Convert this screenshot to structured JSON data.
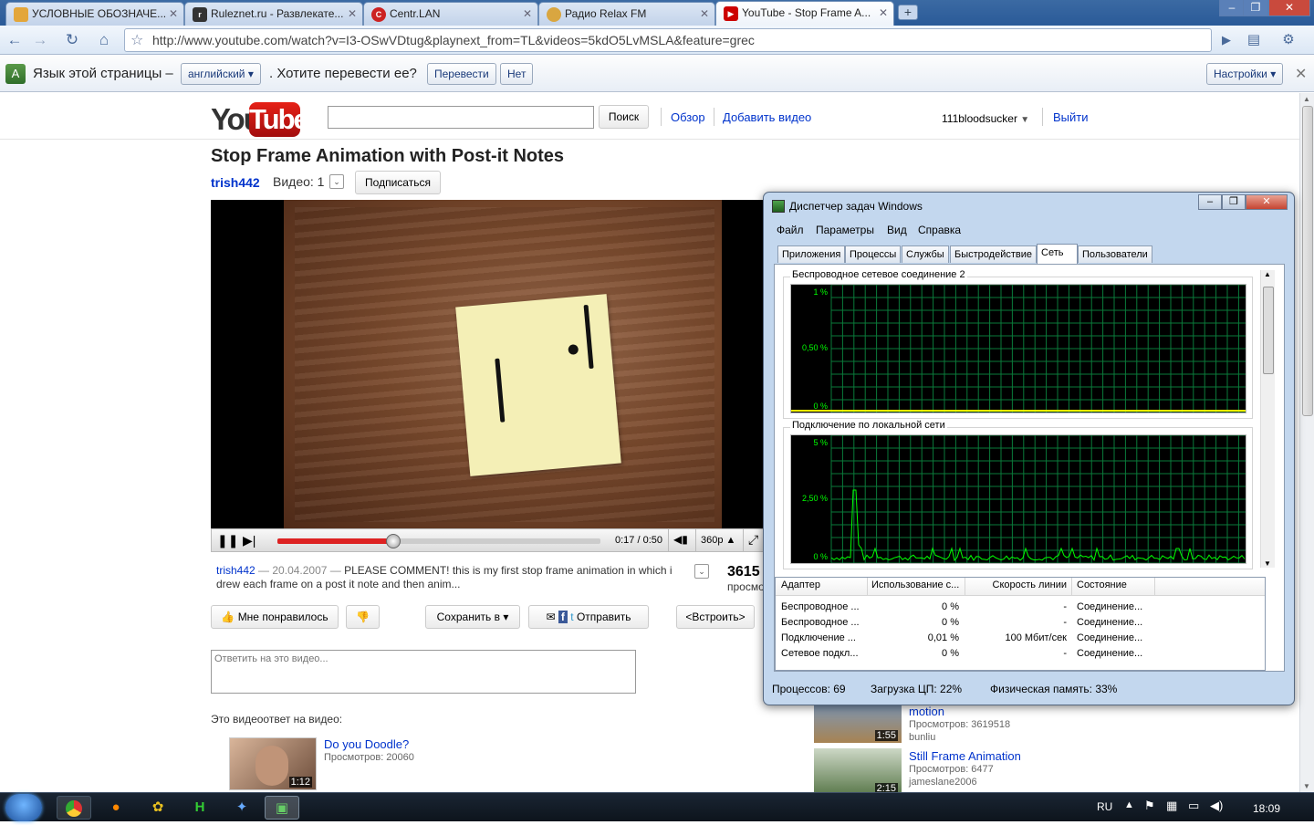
{
  "browser": {
    "tabs": [
      {
        "label": "УСЛОВНЫЕ ОБОЗНАЧЕ...",
        "icon": "page-icon",
        "color": "#e3a63a"
      },
      {
        "label": "Ruleznet.ru - Развлекате...",
        "icon": "ruleznet-icon",
        "color": "#333333"
      },
      {
        "label": "Centr.LAN",
        "icon": "centr-icon",
        "color": "#cc2222"
      },
      {
        "label": "Радио Relax FM",
        "icon": "radio-icon",
        "color": "#d9a640"
      },
      {
        "label": "YouTube - Stop Frame A...",
        "icon": "youtube-icon",
        "color": "#cc0000"
      }
    ],
    "new_tab": "+",
    "url": "http://www.youtube.com/watch?v=I3-OSwVDtug&playnext_from=TL&videos=5kdO5LvMSLA&feature=grec",
    "infobar": {
      "text1": "Язык этой страницы –",
      "language": "английский",
      "text2": ". Хотите перевести ее?",
      "translate": "Перевести",
      "no": "Нет",
      "settings": "Настройки"
    }
  },
  "youtube": {
    "logo_you": "You",
    "logo_tube": "Tube",
    "search_button": "Поиск",
    "nav_browse": "Обзор",
    "nav_upload": "Добавить видео",
    "username": "111bloodsucker",
    "logout": "Выйти",
    "video_title": "Stop Frame Animation with Post-it Notes",
    "channel": "trish442",
    "videos_label": "Видео: 1",
    "subscribe": "Подписаться",
    "player": {
      "time": "0:17 / 0:50",
      "quality": "360p",
      "progress": 0.36
    },
    "desc_user": "trish442",
    "desc_date": "— 20.04.2007 —",
    "desc_text": "PLEASE COMMENT! this is my first stop frame animation in which i drew each frame on a post it note and then anim...",
    "views_partial": "3615",
    "views_label_partial": "просмо",
    "like": "Мне понравилось",
    "save_to": "Сохранить в",
    "share": "Отправить",
    "embed": "<Встроить>",
    "reply_placeholder": "Ответить на это видео...",
    "response_label": "Это видеоответ на видео:",
    "response_video": {
      "title": "Do you Doodle?",
      "views": "Просмотров: 20060",
      "duration": "1:12"
    },
    "related": [
      {
        "title": "motion",
        "views": "Просмотров: 3619518",
        "user": "bunliu",
        "duration": "1:55"
      },
      {
        "title": "Still Frame Animation",
        "views": "Просмотров: 6477",
        "user": "jameslane2006",
        "duration": "2:15"
      }
    ]
  },
  "taskmgr": {
    "title": "Диспетчер задач Windows",
    "menu": [
      "Файл",
      "Параметры",
      "Вид",
      "Справка"
    ],
    "tabs": [
      "Приложения",
      "Процессы",
      "Службы",
      "Быстродействие",
      "Сеть",
      "Пользователи"
    ],
    "graph1": {
      "label": "Беспроводное сетевое соединение 2",
      "y_top": "1 %",
      "y_mid": "0,50 %",
      "y_bot": "0 %"
    },
    "graph2": {
      "label": "Подключение по локальной сети",
      "y_top": "5 %",
      "y_mid": "2,50 %",
      "y_bot": "0 %"
    },
    "columns": [
      "Адаптер",
      "Использование с...",
      "Скорость линии",
      "Состояние"
    ],
    "rows": [
      [
        "Беспроводное ...",
        "0 %",
        "-",
        "Соединение..."
      ],
      [
        "Беспроводное ...",
        "0 %",
        "-",
        "Соединение..."
      ],
      [
        "Подключение ...",
        "0,01 %",
        "100 Мбит/сек",
        "Соединение..."
      ],
      [
        "Сетевое подкл...",
        "0 %",
        "-",
        "Соединение..."
      ]
    ],
    "status": {
      "processes": "Процессов: 69",
      "cpu": "Загрузка ЦП: 22%",
      "memory": "Физическая память: 33%"
    }
  },
  "taskbar": {
    "lang": "RU",
    "time": "18:09"
  }
}
